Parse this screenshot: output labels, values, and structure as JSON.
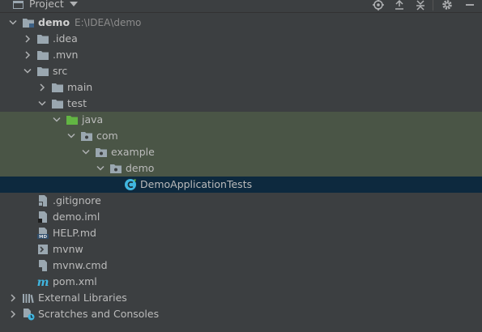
{
  "toolbar": {
    "title": "Project",
    "icons": [
      "locate-icon",
      "expand-all-icon",
      "collapse-all-icon",
      "gear-icon",
      "minimize-icon"
    ]
  },
  "tree": [
    {
      "label": "demo",
      "path": "E:\\IDEA\\demo",
      "bold": true,
      "depth": 0,
      "arrow": "down",
      "icon": "module-folder-icon"
    },
    {
      "label": ".idea",
      "depth": 1,
      "arrow": "right",
      "icon": "folder-icon"
    },
    {
      "label": ".mvn",
      "depth": 1,
      "arrow": "right",
      "icon": "folder-icon"
    },
    {
      "label": "src",
      "depth": 1,
      "arrow": "down",
      "icon": "folder-icon"
    },
    {
      "label": "main",
      "depth": 2,
      "arrow": "right",
      "icon": "folder-icon"
    },
    {
      "label": "test",
      "depth": 2,
      "arrow": "down",
      "icon": "folder-icon"
    },
    {
      "label": "java",
      "depth": 3,
      "arrow": "down",
      "icon": "test-source-folder-icon",
      "highlight": true
    },
    {
      "label": "com",
      "depth": 4,
      "arrow": "down",
      "icon": "package-icon",
      "highlight": true
    },
    {
      "label": "example",
      "depth": 5,
      "arrow": "down",
      "icon": "package-icon",
      "highlight": true
    },
    {
      "label": "demo",
      "depth": 6,
      "arrow": "down",
      "icon": "package-icon",
      "highlight": true
    },
    {
      "label": "DemoApplicationTests",
      "depth": 7,
      "arrow": "none",
      "icon": "java-class-icon",
      "selected": true
    },
    {
      "label": ".gitignore",
      "depth": 1,
      "arrow": "none",
      "icon": "gitignore-file-icon"
    },
    {
      "label": "demo.iml",
      "depth": 1,
      "arrow": "none",
      "icon": "iml-file-icon"
    },
    {
      "label": "HELP.md",
      "depth": 1,
      "arrow": "none",
      "icon": "markdown-file-icon"
    },
    {
      "label": "mvnw",
      "depth": 1,
      "arrow": "none",
      "icon": "shell-script-icon"
    },
    {
      "label": "mvnw.cmd",
      "depth": 1,
      "arrow": "none",
      "icon": "cmd-file-icon"
    },
    {
      "label": "pom.xml",
      "depth": 1,
      "arrow": "none",
      "icon": "maven-pom-icon"
    },
    {
      "label": "External Libraries",
      "depth": 0,
      "arrow": "right",
      "icon": "libraries-icon"
    },
    {
      "label": "Scratches and Consoles",
      "depth": 0,
      "arrow": "right",
      "icon": "scratches-icon"
    }
  ],
  "colors": {
    "background": "#3c3f41",
    "highlight_row": "#4a5546",
    "selected_row": "#0d293e",
    "folder": "#9aa7b0",
    "test_folder": "#62b543",
    "java_class": "#40b6e0"
  }
}
